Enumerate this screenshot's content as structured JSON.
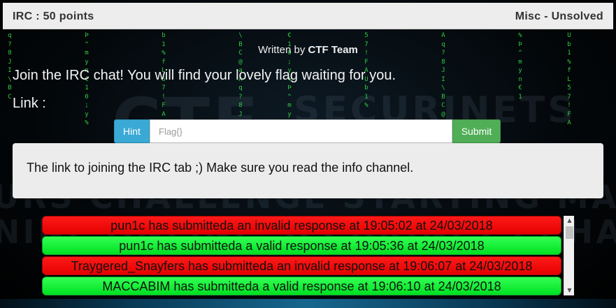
{
  "challenge": {
    "title": "IRC : 50 points",
    "status": "Misc - Unsolved",
    "author_prefix": "Written by",
    "author_name": "CTF Team",
    "description": "Join the IRC chat! You will find your lovely flag waiting for you.",
    "link_label": "Link :"
  },
  "form": {
    "hint_label": "Hint",
    "flag_placeholder": "Flag{}",
    "flag_value": "",
    "submit_label": "Submit"
  },
  "hint": {
    "text": "The link to joining the IRC tab ;) Make sure you read the info channel."
  },
  "submissions": [
    {
      "text": "pun1c has submitteda an invalid response at 19:05:02 at 24/03/2018",
      "result": "invalid"
    },
    {
      "text": "pun1c has submitteda a valid response at 19:05:36 at 24/03/2018",
      "result": "valid"
    },
    {
      "text": "Traygered_Snayfers has submitteda an invalid response at 19:06:07 at 24/03/2018",
      "result": "invalid"
    },
    {
      "text": "MACCABIM has submitteda a valid response at 19:06:10 at 24/03/2018",
      "result": "valid"
    }
  ],
  "scrollbar": {
    "up_icon": "▲",
    "down_icon": "▼"
  },
  "colors": {
    "invalid": "#ff0000",
    "valid": "#00ff33",
    "hint_button": "#3aa9d6",
    "submit_button": "#4fae56",
    "matrix_green": "#2ecc40"
  }
}
